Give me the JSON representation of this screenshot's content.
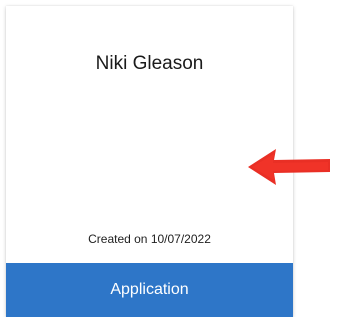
{
  "card": {
    "name": "Niki Gleason",
    "created_text": "Created on 10/07/2022",
    "action_label": "Application"
  },
  "colors": {
    "action_bg": "#2e76c8",
    "annotation_arrow": "#e8261c"
  },
  "annotation": {
    "icon": "arrow-left-icon"
  }
}
